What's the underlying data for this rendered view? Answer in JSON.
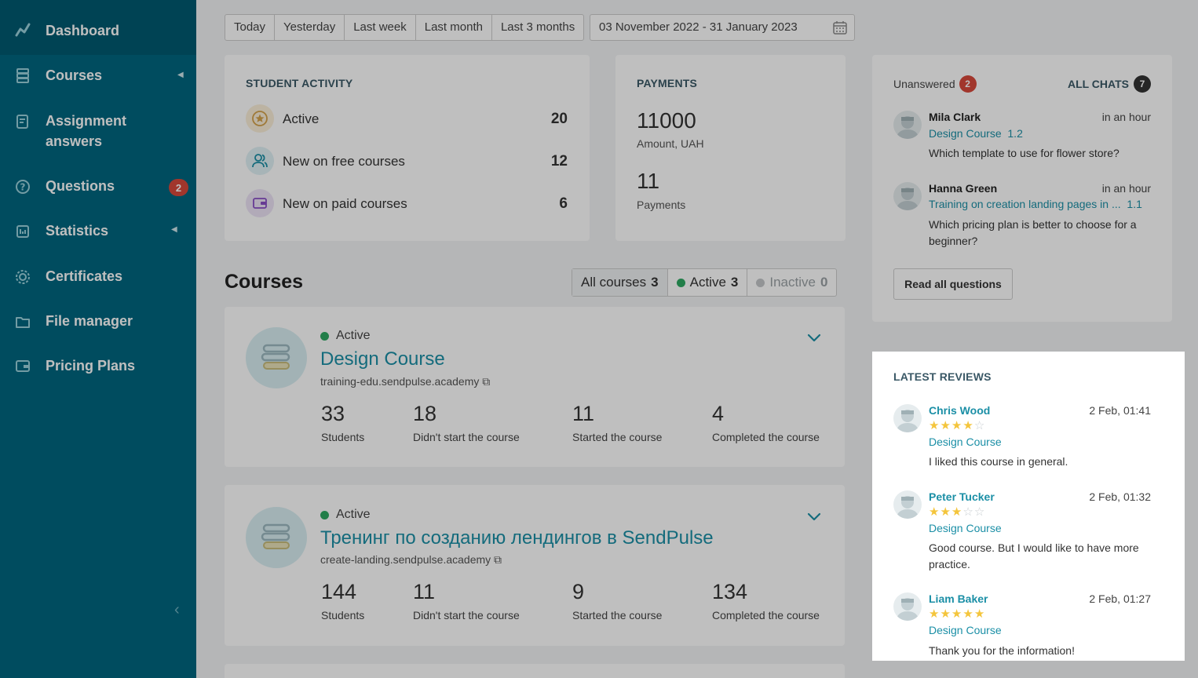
{
  "sidebar": {
    "items": [
      {
        "label": "Dashboard"
      },
      {
        "label": "Courses"
      },
      {
        "label": "Assignment answers"
      },
      {
        "label": "Questions",
        "badge": "2"
      },
      {
        "label": "Statistics"
      },
      {
        "label": "Certificates"
      },
      {
        "label": "File manager"
      },
      {
        "label": "Pricing Plans"
      }
    ]
  },
  "date_filter": {
    "tabs": [
      "Today",
      "Yesterday",
      "Last week",
      "Last month",
      "Last 3 months"
    ],
    "range": "03 November 2022 - 31 January 2023"
  },
  "student_activity": {
    "title": "STUDENT ACTIVITY",
    "rows": [
      {
        "label": "Active",
        "value": "20"
      },
      {
        "label": "New on free courses",
        "value": "12"
      },
      {
        "label": "New on paid courses",
        "value": "6"
      }
    ]
  },
  "payments": {
    "title": "PAYMENTS",
    "amount_value": "11000",
    "amount_label": "Amount, UAH",
    "count_value": "11",
    "count_label": "Payments"
  },
  "chats": {
    "unanswered_label": "Unanswered",
    "unanswered_count": "2",
    "all_chats_label": "ALL CHATS",
    "all_chats_count": "7",
    "items": [
      {
        "name": "Mila Clark",
        "time": "in an hour",
        "course": "Design Course",
        "lesson": "1.2",
        "text": "Which template to use for flower store?"
      },
      {
        "name": "Hanna Green",
        "time": "in an hour",
        "course": "Training on creation landing pages in ...",
        "lesson": "1.1",
        "text": "Which pricing plan is better to choose for a beginner?"
      }
    ],
    "read_all_label": "Read all questions"
  },
  "courses": {
    "title": "Courses",
    "filters": [
      {
        "label": "All courses",
        "count": "3"
      },
      {
        "label": "Active",
        "count": "3"
      },
      {
        "label": "Inactive",
        "count": "0"
      }
    ],
    "items": [
      {
        "status": "Active",
        "title": "Design Course",
        "url": "training-edu.sendpulse.academy",
        "stats": [
          {
            "value": "33",
            "label": "Students"
          },
          {
            "value": "18",
            "label": "Didn't start the course"
          },
          {
            "value": "11",
            "label": "Started the course"
          },
          {
            "value": "4",
            "label": "Completed the course"
          }
        ]
      },
      {
        "status": "Active",
        "title": "Тренинг по созданию лендингов в SendPulse",
        "url": "create-landing.sendpulse.academy",
        "stats": [
          {
            "value": "144",
            "label": "Students"
          },
          {
            "value": "11",
            "label": "Didn't start the course"
          },
          {
            "value": "9",
            "label": "Started the course"
          },
          {
            "value": "134",
            "label": "Completed the course"
          }
        ]
      }
    ]
  },
  "reviews": {
    "title": "LATEST REVIEWS",
    "items": [
      {
        "name": "Chris Wood",
        "time": "2 Feb, 01:41",
        "rating": 4,
        "course": "Design Course",
        "text": "I liked this course in general."
      },
      {
        "name": "Peter Tucker",
        "time": "2 Feb, 01:32",
        "rating": 3,
        "course": "Design Course",
        "text": "Good course. But I would like to have more practice."
      },
      {
        "name": "Liam Baker",
        "time": "2 Feb, 01:27",
        "rating": 5,
        "course": "Design Course",
        "text": "Thank you for the information!"
      }
    ]
  },
  "colors": {
    "sidebar": "#00667f",
    "accent": "#1b8fa6",
    "active_dot": "#2ea862",
    "badge_red": "#d7483b",
    "star": "#f4c53c"
  }
}
